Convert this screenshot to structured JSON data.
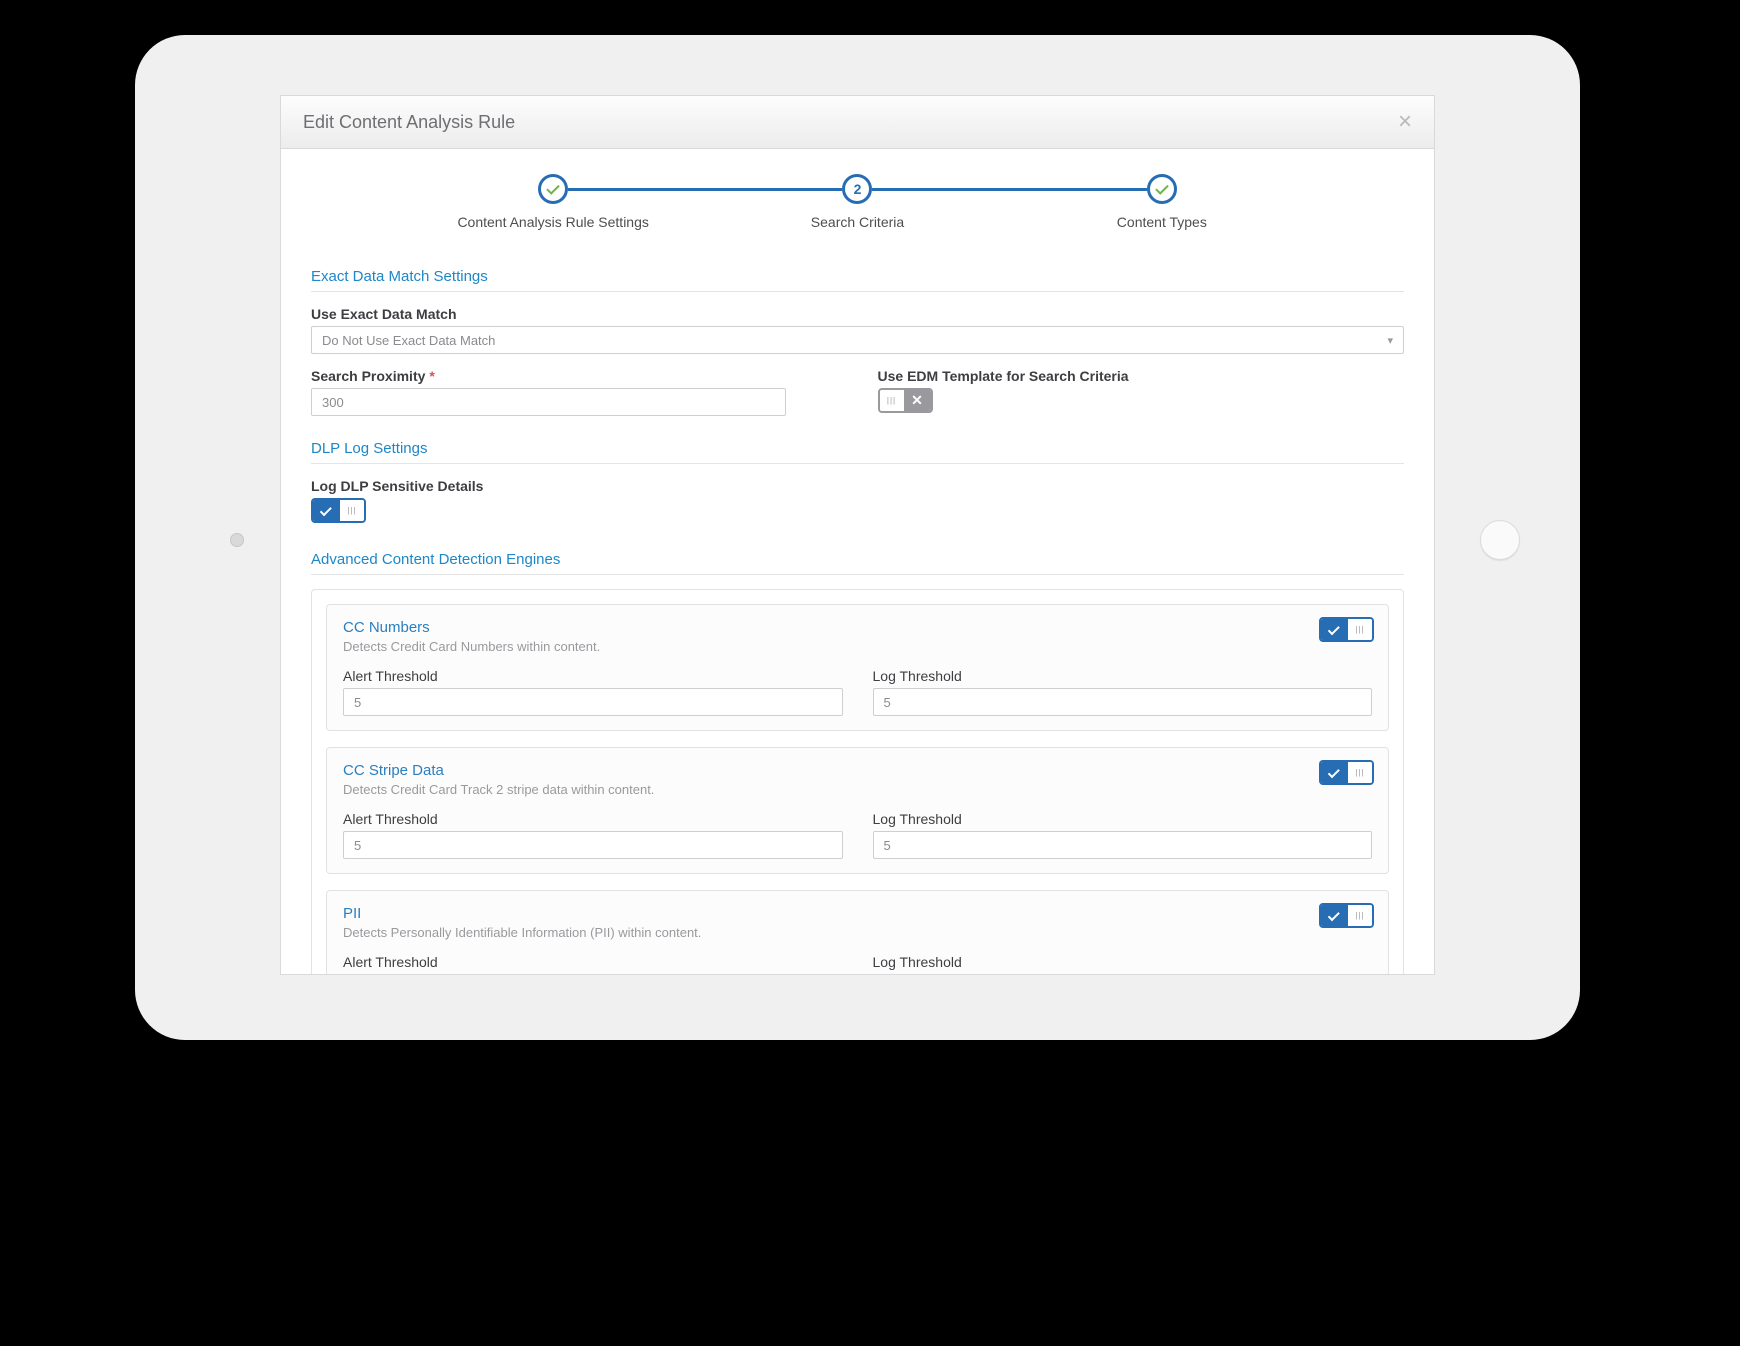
{
  "modal": {
    "title": "Edit Content Analysis Rule"
  },
  "stepper": {
    "steps": [
      {
        "label": "Content Analysis Rule Settings",
        "state": "done"
      },
      {
        "label": "Search Criteria",
        "state": "current",
        "num": "2"
      },
      {
        "label": "Content Types",
        "state": "done"
      }
    ]
  },
  "sections": {
    "edm": {
      "title": "Exact Data Match Settings",
      "use_label": "Use Exact Data Match",
      "use_value": "Do Not Use Exact Data Match",
      "proximity_label": "Search Proximity",
      "proximity_value": "300",
      "template_label": "Use EDM Template for Search Criteria",
      "template_toggle": "off"
    },
    "dlp": {
      "title": "DLP Log Settings",
      "log_label": "Log DLP Sensitive Details",
      "log_toggle": "on"
    },
    "engines": {
      "title": "Advanced Content Detection Engines",
      "alert_label": "Alert Threshold",
      "log_label": "Log Threshold",
      "list": [
        {
          "title": "CC Numbers",
          "desc": "Detects Credit Card Numbers within content.",
          "alert": "5",
          "log": "5",
          "toggle": "on"
        },
        {
          "title": "CC Stripe Data",
          "desc": "Detects Credit Card Track 2 stripe data within content.",
          "alert": "5",
          "log": "5",
          "toggle": "on"
        },
        {
          "title": "PII",
          "desc": "Detects Personally Identifiable Information (PII) within content.",
          "alert": "",
          "log": "",
          "toggle": "on"
        }
      ]
    }
  }
}
